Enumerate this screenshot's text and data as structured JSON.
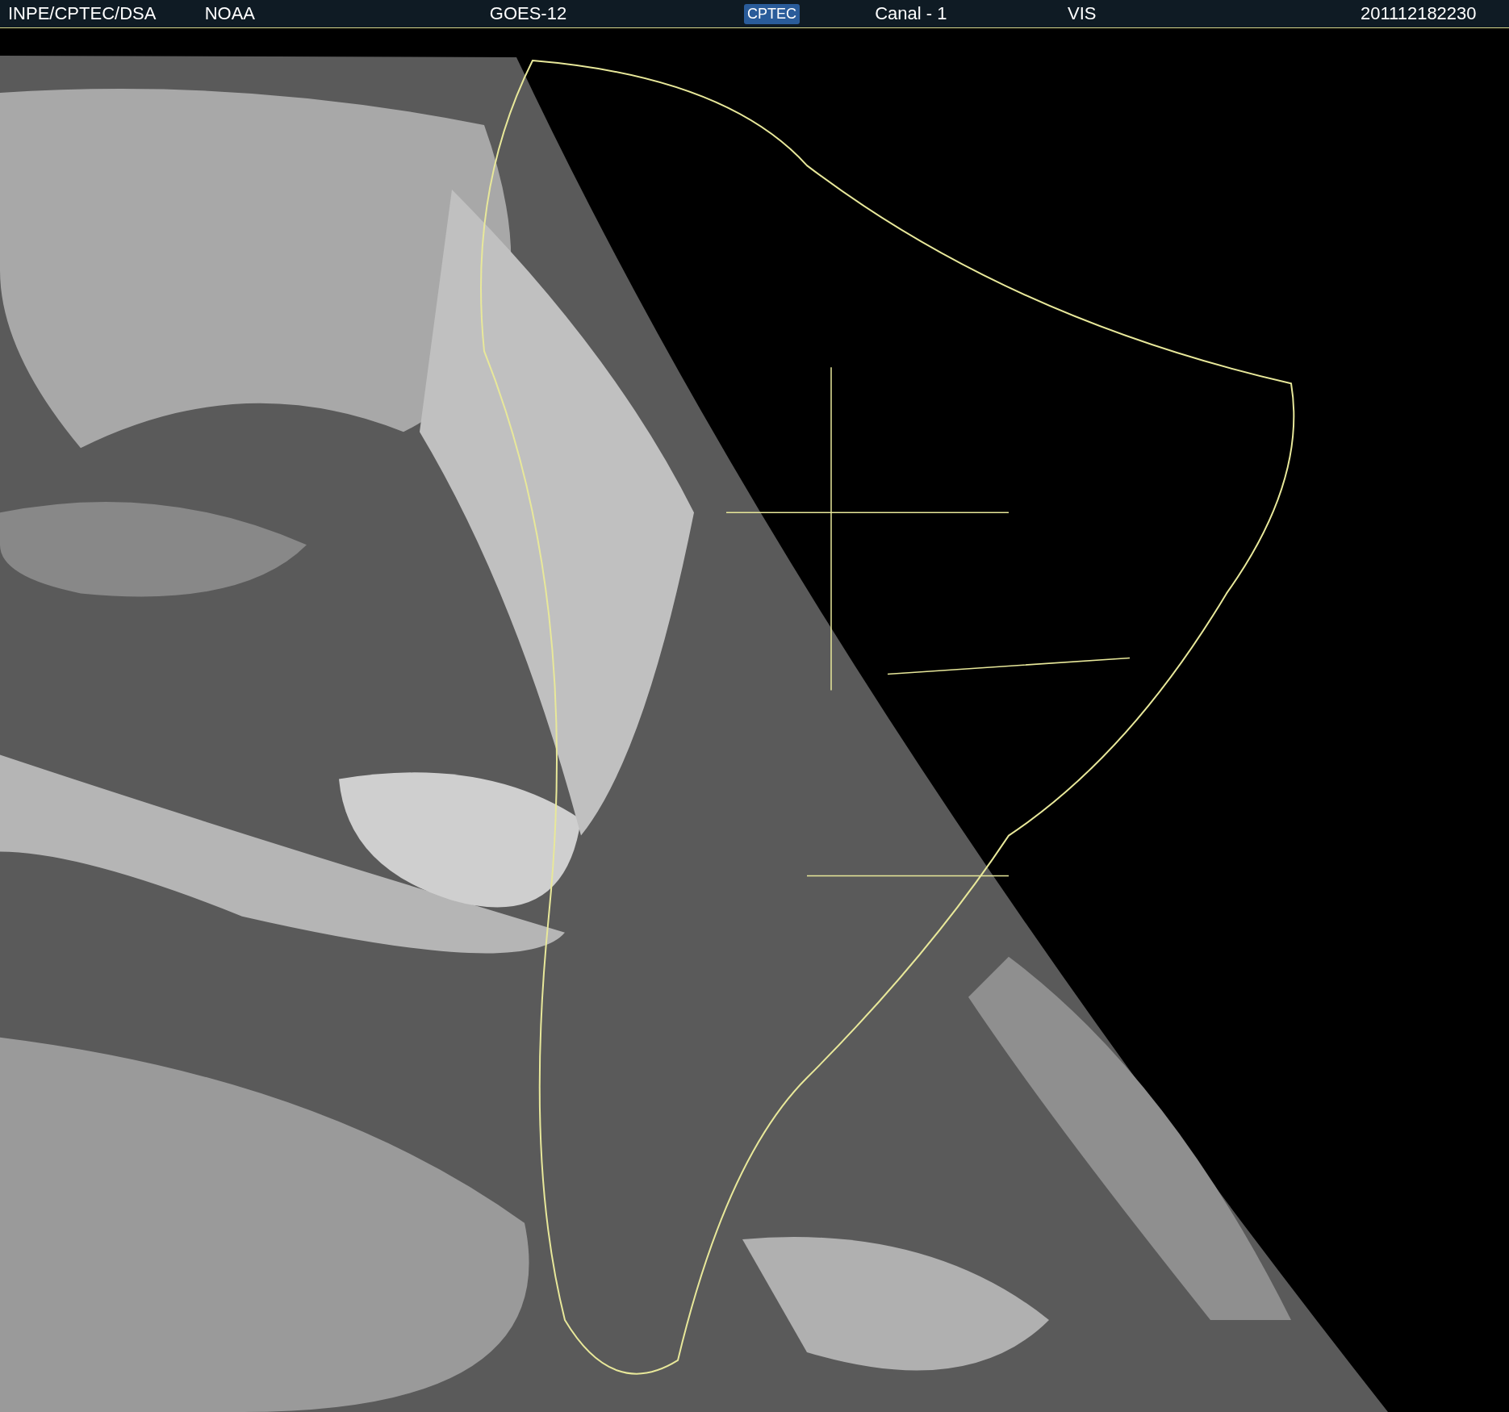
{
  "header": {
    "items": [
      {
        "kind": "text",
        "text": "INPE/CPTEC/DSA"
      },
      {
        "kind": "text",
        "text": "NOAA"
      },
      {
        "kind": "text",
        "text": "GOES-12"
      },
      {
        "kind": "logo",
        "text": "CPTEC"
      },
      {
        "kind": "text",
        "text": "Canal - 1"
      },
      {
        "kind": "text",
        "text": "VIS"
      },
      {
        "kind": "text",
        "text": "201112182230"
      }
    ]
  }
}
